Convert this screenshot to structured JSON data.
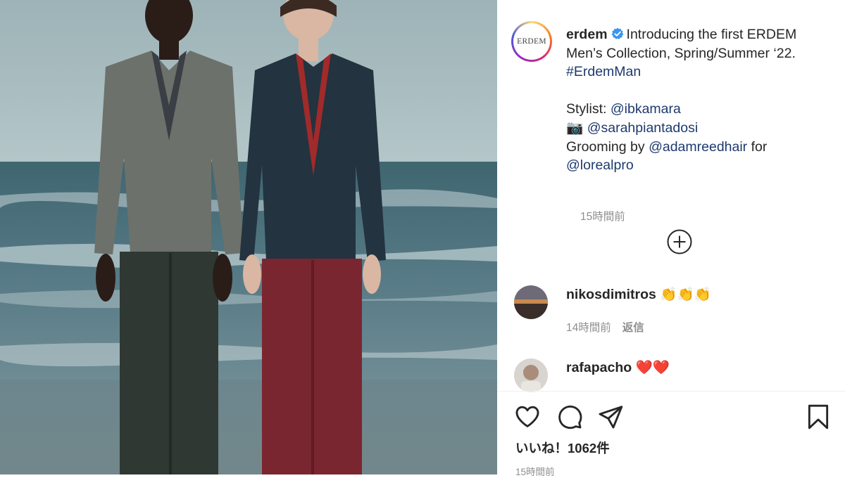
{
  "post": {
    "author": "erdem",
    "logo_text": "ERDEM",
    "caption_intro": "Introducing the first ERDEM Men’s Collection, Spring/Summer ‘22.",
    "hashtag": "#ErdemMan",
    "stylist_label": "Stylist:",
    "stylist": "@ibkamara",
    "camera_emoji": "📷",
    "photographer": "@sarahpiantadosi",
    "grooming_label": "Grooming by",
    "groomer": "@adamreedhair",
    "for_label": "for",
    "brand": "@lorealpro",
    "caption_time": "15時間前"
  },
  "comments": [
    {
      "user": "nikosdimitros",
      "text": "👏👏👏",
      "time": "14時間前",
      "reply_label": "返信"
    },
    {
      "user": "rafapacho",
      "text": "❤️❤️"
    }
  ],
  "actions": {
    "icons": [
      "heart-icon",
      "comment-icon",
      "share-icon",
      "bookmark-icon"
    ],
    "likes_label": "いいね！1062件",
    "post_time": "15時間前"
  },
  "colors": {
    "link": "#1e3a6e",
    "verified": "#3897f0",
    "muted": "#8e8e8e"
  }
}
